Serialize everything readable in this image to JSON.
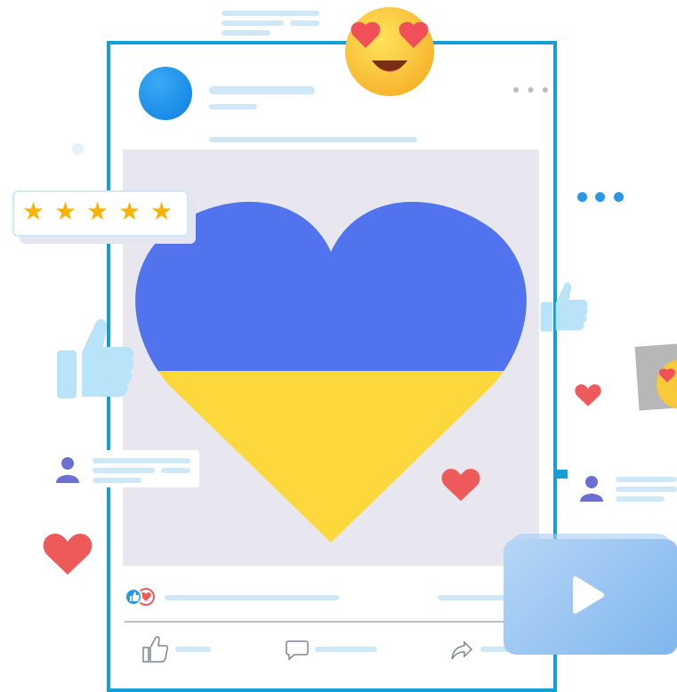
{
  "colors": {
    "frame_border": "#159fd4",
    "heart_blue": "#5174ee",
    "heart_yellow": "#fdd83d",
    "reaction_heart": "#ee5a5a",
    "placeholder_line": "#cfe8f7",
    "star": "#f5b400",
    "thumb": "#b9e3f8",
    "video_card": "#8cbdf0"
  },
  "icons": {
    "avatar": "avatar-circle",
    "menu": "more-dots-icon",
    "emoji": "heart-eyes-emoji",
    "rating": "star-icon",
    "like": "thumbs-up-icon",
    "heart": "heart-icon",
    "user": "user-icon",
    "comment": "speech-bubble-icon",
    "share": "share-arrow-icon",
    "play": "play-icon"
  },
  "rating": {
    "stars_filled": 5,
    "stars_total": 5
  },
  "post_image": {
    "subject": "heart",
    "fill_split_blue_top_yellow_bottom": 0.5
  }
}
